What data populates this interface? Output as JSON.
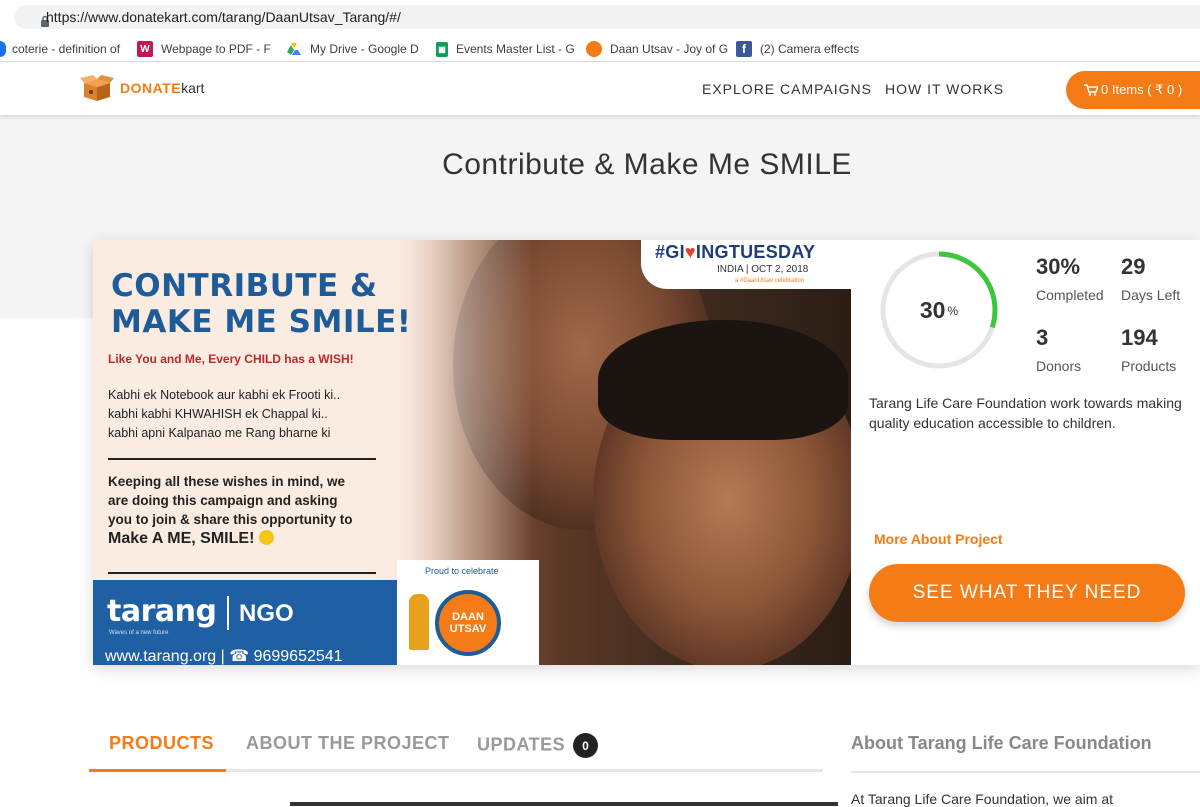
{
  "browser": {
    "url": "https://www.donatekart.com/tarang/DaanUtsav_Tarang/#/",
    "bookmarks": [
      {
        "label": "coterie - definition of",
        "icon": "blue-circle-icon"
      },
      {
        "label": "Webpage to PDF - F",
        "icon": "w-logo-icon"
      },
      {
        "label": "My Drive - Google D",
        "icon": "google-drive-icon"
      },
      {
        "label": "Events Master List - G",
        "icon": "google-sheets-icon"
      },
      {
        "label": "Daan Utsav - Joy of G",
        "icon": "daan-utsav-icon"
      },
      {
        "label": "(2) Camera effects",
        "icon": "facebook-icon"
      }
    ]
  },
  "header": {
    "logo_brand": "DONATE",
    "logo_suffix": "kart",
    "nav": [
      "EXPLORE CAMPAIGNS",
      "HOW IT WORKS"
    ],
    "cart_label": "0 Items ( ₹ 0 )"
  },
  "page_title": "Contribute & Make Me SMILE",
  "banner": {
    "headline_1": "CONTRIBUTE &",
    "headline_2": "MAKE ME SMILE!",
    "wish_line": "Like You and Me, Every CHILD has a WISH!",
    "lines": [
      "Kabhi ek  Notebook aur kabhi ek Frooti ki..",
      "kabhi kabhi KHWAHISH ek Chappal ki..",
      "kabhi apni Kalpanao me Rang bharne ki"
    ],
    "keep_1": "Keeping all these wishes in mind, we",
    "keep_2": "are doing this campaign and asking",
    "keep_3": "you to join & share this opportunity to",
    "keep_4": "Make A ME, SMILE!",
    "tarang": "tarang",
    "tagline": "Waves of a new future",
    "ngo": "NGO",
    "website": "www.tarang.org | ☎ 9699652541",
    "giving_hash": "#GI",
    "giving_mid": "♥",
    "giving_rest": "INGTUESDAY",
    "giving_india": "INDIA | OCT 2, 2018",
    "giving_celebration": "a #DaanUtsav celebration",
    "proud": "Proud to celebrate",
    "daan_seal": "DAAN UTSAV"
  },
  "stats": {
    "progress_percent": 30,
    "progress_text": "30",
    "progress_unit": "%",
    "completed_value": "30%",
    "completed_label": "Completed",
    "days_value": "29",
    "days_label": "Days Left",
    "donors_value": "3",
    "donors_label": "Donors",
    "products_value": "194",
    "products_label": "Products"
  },
  "description": "Tarang Life Care Foundation work towards making quality education accessible to children.",
  "more_link": "More About Project",
  "cta": "SEE WHAT THEY NEED",
  "tabs": {
    "products": "PRODUCTS",
    "about": "ABOUT THE PROJECT",
    "updates": "UPDATES",
    "updates_count": "0"
  },
  "aside": {
    "heading": "About Tarang Life Care Foundation",
    "text": "At Tarang Life Care Foundation, we aim at"
  },
  "colors": {
    "accent": "#f47b16",
    "progress": "#3cc63c",
    "banner_blue": "#1f5fa3"
  }
}
